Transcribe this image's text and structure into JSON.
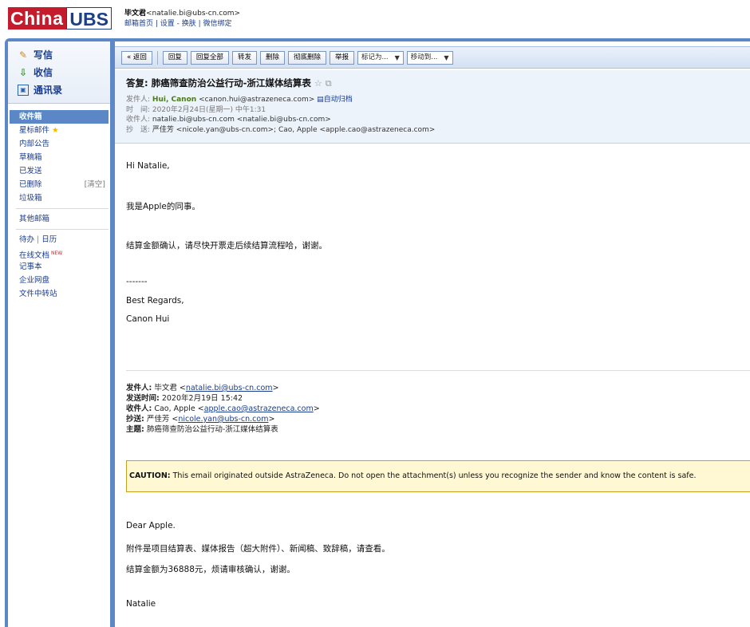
{
  "logo": {
    "part1": "China ",
    "part2": "UBS"
  },
  "user": {
    "name": "毕文君",
    "email": "<natalie.bi@ubs-cn.com>",
    "links": "邮箱首页 | 设置 - 换肤 | 微信绑定"
  },
  "sidebar": {
    "compose": "写信",
    "receive": "收信",
    "contacts": "通讯录",
    "folders": [
      {
        "label": "收件箱"
      },
      {
        "label": "星标邮件"
      },
      {
        "label": "内部公告"
      },
      {
        "label": "草稿箱"
      },
      {
        "label": "已发送"
      },
      {
        "label": "已删除",
        "extra": "[清空]"
      },
      {
        "label": "垃圾箱"
      }
    ],
    "other_mailbox": "其他邮箱",
    "todo": "待办",
    "calendar": "日历",
    "tools": [
      {
        "label": "在线文档",
        "badge": "NEW"
      },
      {
        "label": "记事本"
      },
      {
        "label": "企业网盘"
      },
      {
        "label": "文件中转站"
      }
    ]
  },
  "toolbar": {
    "back": "« 返回",
    "reply": "回复",
    "reply_all": "回复全部",
    "forward": "转发",
    "delete": "删除",
    "delete_permanent": "彻底删除",
    "report": "举报",
    "mark_as": "标记为...",
    "move_to": "移动到..."
  },
  "message": {
    "subject": "答复: 肺癌筛查防治公益行动-浙江媒体结算表",
    "from_label": "发件人:",
    "from_name": "Hui, Canon",
    "from_email": "<canon.hui@astrazeneca.com>",
    "auto_archive": "自动归档",
    "time_label": "时　间:",
    "time": "2020年2月24日(星期一) 中午1:31",
    "to_label": "收件人:",
    "to": "natalie.bi@ubs-cn.com <natalie.bi@ubs-cn.com>",
    "cc_label": "抄　送:",
    "cc": "严佳芳 <nicole.yan@ubs-cn.com>; Cao, Apple <apple.cao@astrazeneca.com>"
  },
  "body": {
    "greeting": "Hi Natalie,",
    "line1": "我是Apple的同事。",
    "line2": "结算金额确认，请尽快开票走后续结算流程哈，谢谢。",
    "dashes": "-------",
    "regards": "Best Regards,",
    "signature": "Canon Hui",
    "fwd_from_label": "发件人:",
    "fwd_from_name": "毕文君 <",
    "fwd_from_email": "natalie.bi@ubs-cn.com",
    "fwd_sent_label": "发送时间:",
    "fwd_sent": "2020年2月19日 15:42",
    "fwd_to_label": "收件人:",
    "fwd_to_name": "Cao, Apple <",
    "fwd_to_email": "apple.cao@astrazeneca.com",
    "fwd_cc_label": "抄送:",
    "fwd_cc_name": "严佳芳 <",
    "fwd_cc_email": "nicole.yan@ubs-cn.com",
    "fwd_subject_label": "主题:",
    "fwd_subject": "肺癌筛查防治公益行动-浙江媒体结算表",
    "caution_label": "CAUTION:",
    "caution_text": "This email originated outside AstraZeneca. Do not open the attachment(s) unless you recognize the sender and know the content is safe.",
    "dear": "Dear Apple.",
    "orig_line1": "附件是项目结算表、媒体报告（超大附件）、新闻稿、致辞稿，请查看。",
    "orig_line2": "结算金额为36888元，烦请审核确认，谢谢。",
    "orig_sign": "Natalie"
  }
}
